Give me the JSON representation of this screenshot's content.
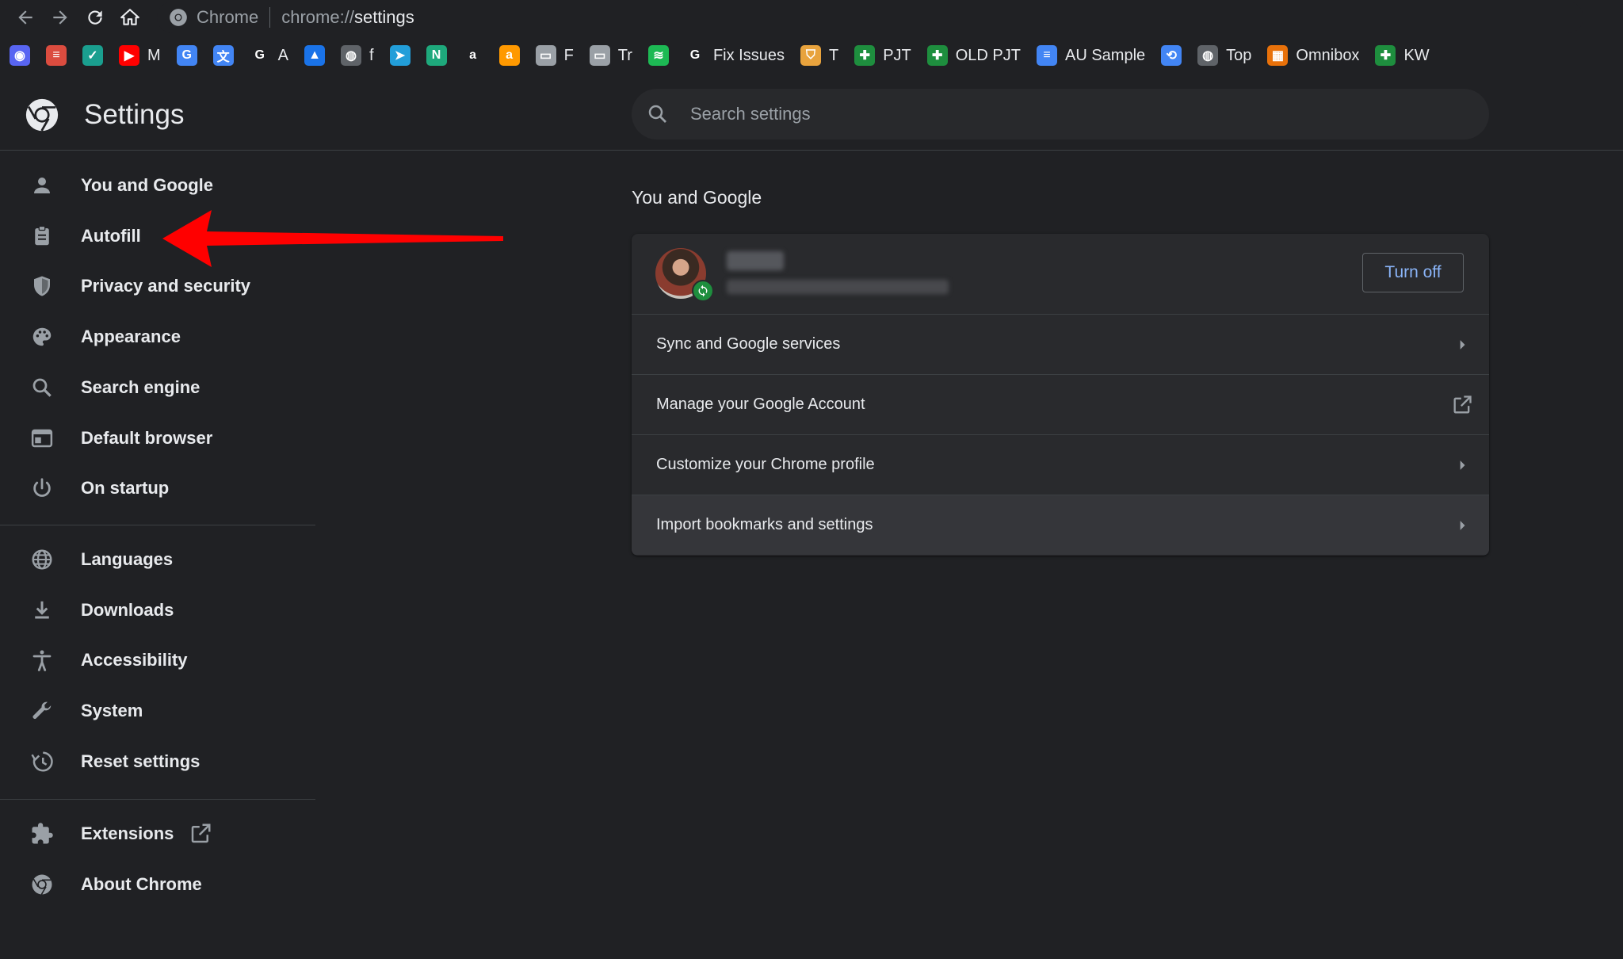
{
  "browser": {
    "site_name": "Chrome",
    "url_scheme": "chrome://",
    "url_host": "settings"
  },
  "bookmarks": [
    {
      "icon": "discord-icon",
      "label": "",
      "color": "#5865F2",
      "glyph": "◉"
    },
    {
      "icon": "todoist-icon",
      "label": "",
      "color": "#DB4C3F",
      "glyph": "≡"
    },
    {
      "icon": "check-circle-icon",
      "label": "",
      "color": "#1a9f8f",
      "glyph": "✓"
    },
    {
      "icon": "youtube-icon",
      "label": "M",
      "color": "#FF0000",
      "glyph": "▶"
    },
    {
      "icon": "google-one-icon",
      "label": "",
      "color": "#4285F4",
      "glyph": "G"
    },
    {
      "icon": "google-translate-icon",
      "label": "",
      "color": "#4285F4",
      "glyph": "文"
    },
    {
      "icon": "google-icon",
      "label": "A",
      "color": "#ffffff",
      "glyph": "G"
    },
    {
      "icon": "flask-icon",
      "label": "",
      "color": "#1a73e8",
      "glyph": "▲"
    },
    {
      "icon": "globe-icon",
      "label": "f",
      "color": "#5f6368",
      "glyph": "◍"
    },
    {
      "icon": "telegram-icon",
      "label": "",
      "color": "#229ED9",
      "glyph": "➤"
    },
    {
      "icon": "n-app-icon",
      "label": "",
      "color": "#1ea97c",
      "glyph": "N"
    },
    {
      "icon": "amazon-icon",
      "label": "",
      "color": "#ffffff",
      "glyph": "a"
    },
    {
      "icon": "amazon-a-icon",
      "label": "",
      "color": "#FF9900",
      "glyph": "a"
    },
    {
      "icon": "folder-icon",
      "label": "F",
      "color": "#9aa0a6",
      "glyph": "▭"
    },
    {
      "icon": "folder-icon",
      "label": "Tr",
      "color": "#9aa0a6",
      "glyph": "▭"
    },
    {
      "icon": "spotify-icon",
      "label": "",
      "color": "#1DB954",
      "glyph": "≋"
    },
    {
      "icon": "google-icon",
      "label": "Fix Issues",
      "color": "#ffffff",
      "glyph": "G"
    },
    {
      "icon": "shield-badge-icon",
      "label": "T",
      "color": "#e8a33d",
      "glyph": "⛉"
    },
    {
      "icon": "sheets-icon",
      "label": "PJT",
      "color": "#1e8e3e",
      "glyph": "✚"
    },
    {
      "icon": "sheets-icon",
      "label": "OLD PJT",
      "color": "#1e8e3e",
      "glyph": "✚"
    },
    {
      "icon": "docs-icon",
      "label": "AU Sample",
      "color": "#4285F4",
      "glyph": "≡"
    },
    {
      "icon": "link-icon",
      "label": "",
      "color": "#4285F4",
      "glyph": "⟲"
    },
    {
      "icon": "globe-icon",
      "label": "Top",
      "color": "#5f6368",
      "glyph": "◍"
    },
    {
      "icon": "omnibox-sheet-icon",
      "label": "Omnibox",
      "color": "#e8710a",
      "glyph": "▦"
    },
    {
      "icon": "sheets-icon",
      "label": "KW",
      "color": "#1e8e3e",
      "glyph": "✚"
    }
  ],
  "header": {
    "title": "Settings",
    "search_placeholder": "Search settings"
  },
  "sidebar": {
    "group1": [
      {
        "label": "You and Google",
        "icon": "person-icon"
      },
      {
        "label": "Autofill",
        "icon": "clipboard-icon"
      },
      {
        "label": "Privacy and security",
        "icon": "shield-icon"
      },
      {
        "label": "Appearance",
        "icon": "palette-icon"
      },
      {
        "label": "Search engine",
        "icon": "search-icon"
      },
      {
        "label": "Default browser",
        "icon": "browser-window-icon"
      },
      {
        "label": "On startup",
        "icon": "power-icon"
      }
    ],
    "group2": [
      {
        "label": "Languages",
        "icon": "globe-icon"
      },
      {
        "label": "Downloads",
        "icon": "download-icon"
      },
      {
        "label": "Accessibility",
        "icon": "accessibility-icon"
      },
      {
        "label": "System",
        "icon": "wrench-icon"
      },
      {
        "label": "Reset settings",
        "icon": "restore-icon"
      }
    ],
    "group3": [
      {
        "label": "Extensions",
        "icon": "puzzle-icon"
      },
      {
        "label": "About Chrome",
        "icon": "chrome-icon"
      }
    ]
  },
  "main": {
    "section_title": "You and Google",
    "account": {
      "turn_off_label": "Turn off"
    },
    "rows": [
      {
        "label": "Sync and Google services",
        "icon": "chevron-right-icon"
      },
      {
        "label": "Manage your Google Account",
        "icon": "external-link-icon"
      },
      {
        "label": "Customize your Chrome profile",
        "icon": "chevron-right-icon"
      },
      {
        "label": "Import bookmarks and settings",
        "icon": "chevron-right-icon"
      }
    ]
  },
  "colors": {
    "background": "#202124",
    "card": "#292a2d",
    "accent": "#8ab4f8",
    "annotation": "#ff0000"
  }
}
